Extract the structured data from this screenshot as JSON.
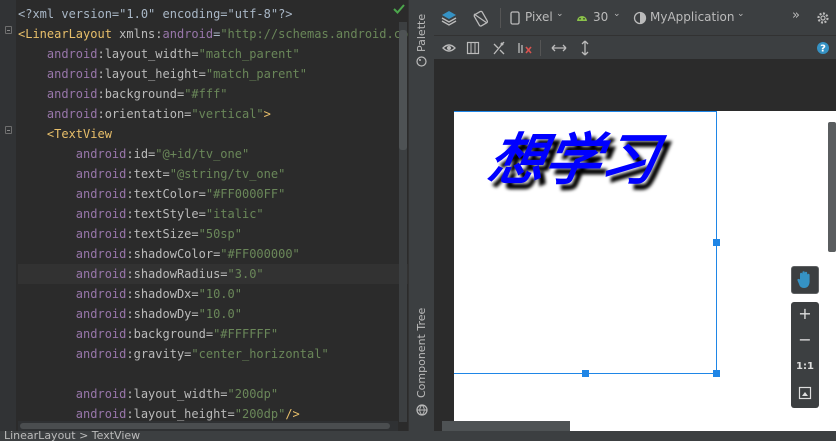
{
  "editor": {
    "lines": [
      [
        {
          "t": "<?xml version=\"1.0\" encoding=\"utf-8\"?>",
          "c": "tok-plain"
        }
      ],
      [
        {
          "t": "<LinearLayout ",
          "c": "tok-tag"
        },
        {
          "t": "xmlns:",
          "c": "tok-attr"
        },
        {
          "t": "android",
          "c": "tok-ns"
        },
        {
          "t": "=",
          "c": "tok-plain"
        },
        {
          "t": "\"http://schemas.android.com/",
          "c": "tok-str"
        }
      ],
      [
        {
          "t": "    ",
          "c": "tok-plain"
        },
        {
          "t": "android",
          "c": "tok-ns"
        },
        {
          "t": ":layout_width=",
          "c": "tok-attr"
        },
        {
          "t": "\"match_parent\"",
          "c": "tok-str"
        }
      ],
      [
        {
          "t": "    ",
          "c": "tok-plain"
        },
        {
          "t": "android",
          "c": "tok-ns"
        },
        {
          "t": ":layout_height=",
          "c": "tok-attr"
        },
        {
          "t": "\"match_parent\"",
          "c": "tok-str"
        }
      ],
      [
        {
          "t": "    ",
          "c": "tok-plain"
        },
        {
          "t": "android",
          "c": "tok-ns"
        },
        {
          "t": ":background=",
          "c": "tok-attr"
        },
        {
          "t": "\"#fff\"",
          "c": "tok-str"
        }
      ],
      [
        {
          "t": "    ",
          "c": "tok-plain"
        },
        {
          "t": "android",
          "c": "tok-ns"
        },
        {
          "t": ":orientation=",
          "c": "tok-attr"
        },
        {
          "t": "\"vertical\"",
          "c": "tok-str"
        },
        {
          "t": ">",
          "c": "tok-tag"
        }
      ],
      [
        {
          "t": "    ",
          "c": "tok-plain"
        },
        {
          "t": "<TextView",
          "c": "tok-tag"
        }
      ],
      [
        {
          "t": "        ",
          "c": "tok-plain"
        },
        {
          "t": "android",
          "c": "tok-ns"
        },
        {
          "t": ":id=",
          "c": "tok-attr"
        },
        {
          "t": "\"@+id/tv_one\"",
          "c": "tok-str"
        }
      ],
      [
        {
          "t": "        ",
          "c": "tok-plain"
        },
        {
          "t": "android",
          "c": "tok-ns"
        },
        {
          "t": ":text=",
          "c": "tok-attr"
        },
        {
          "t": "\"@string/tv_one\"",
          "c": "tok-str"
        }
      ],
      [
        {
          "t": "        ",
          "c": "tok-plain"
        },
        {
          "t": "android",
          "c": "tok-ns"
        },
        {
          "t": ":textColor=",
          "c": "tok-attr"
        },
        {
          "t": "\"#FF0000FF\"",
          "c": "tok-str"
        }
      ],
      [
        {
          "t": "        ",
          "c": "tok-plain"
        },
        {
          "t": "android",
          "c": "tok-ns"
        },
        {
          "t": ":textStyle=",
          "c": "tok-attr"
        },
        {
          "t": "\"italic\"",
          "c": "tok-str"
        }
      ],
      [
        {
          "t": "        ",
          "c": "tok-plain"
        },
        {
          "t": "android",
          "c": "tok-ns"
        },
        {
          "t": ":textSize=",
          "c": "tok-attr"
        },
        {
          "t": "\"50sp\"",
          "c": "tok-str"
        }
      ],
      [
        {
          "t": "        ",
          "c": "tok-plain"
        },
        {
          "t": "android",
          "c": "tok-ns"
        },
        {
          "t": ":shadowColor=",
          "c": "tok-attr"
        },
        {
          "t": "\"#FF000000\"",
          "c": "tok-str"
        }
      ],
      [
        {
          "t": "        ",
          "c": "tok-plain"
        },
        {
          "t": "android",
          "c": "tok-ns"
        },
        {
          "t": ":shadowRadius=",
          "c": "tok-attr"
        },
        {
          "t": "\"3.0\"",
          "c": "tok-str"
        }
      ],
      [
        {
          "t": "        ",
          "c": "tok-plain"
        },
        {
          "t": "android",
          "c": "tok-ns"
        },
        {
          "t": ":shadowDx=",
          "c": "tok-attr"
        },
        {
          "t": "\"10.0\"",
          "c": "tok-str"
        }
      ],
      [
        {
          "t": "        ",
          "c": "tok-plain"
        },
        {
          "t": "android",
          "c": "tok-ns"
        },
        {
          "t": ":shadowDy=",
          "c": "tok-attr"
        },
        {
          "t": "\"10.0\"",
          "c": "tok-str"
        }
      ],
      [
        {
          "t": "        ",
          "c": "tok-plain"
        },
        {
          "t": "android",
          "c": "tok-ns"
        },
        {
          "t": ":background=",
          "c": "tok-attr"
        },
        {
          "t": "\"#FFFFFF\"",
          "c": "tok-str"
        }
      ],
      [
        {
          "t": "        ",
          "c": "tok-plain"
        },
        {
          "t": "android",
          "c": "tok-ns"
        },
        {
          "t": ":gravity=",
          "c": "tok-attr"
        },
        {
          "t": "\"center_horizontal\"",
          "c": "tok-str"
        }
      ],
      [
        {
          "t": "",
          "c": "tok-plain"
        }
      ],
      [
        {
          "t": "        ",
          "c": "tok-plain"
        },
        {
          "t": "android",
          "c": "tok-ns"
        },
        {
          "t": ":layout_width=",
          "c": "tok-attr"
        },
        {
          "t": "\"200dp\"",
          "c": "tok-str"
        }
      ],
      [
        {
          "t": "        ",
          "c": "tok-plain"
        },
        {
          "t": "android",
          "c": "tok-ns"
        },
        {
          "t": ":layout_height=",
          "c": "tok-attr"
        },
        {
          "t": "\"200dp\"",
          "c": "tok-str"
        },
        {
          "t": "/>",
          "c": "tok-tag"
        }
      ]
    ],
    "highlighted_line": 13
  },
  "side_strip": {
    "palette_label": "Palette",
    "component_tree_label": "Component Tree"
  },
  "toolbar": {
    "device": "Pixel",
    "api": "30",
    "app": "MyApplication"
  },
  "preview": {
    "textview_text": "想学习",
    "text_color": "#0000ff",
    "selection_color": "#1f86e6"
  },
  "zoom": {
    "plus": "+",
    "minus": "−",
    "reset": "1:1"
  },
  "statusbar": {
    "breadcrumb": "LinearLayout  >  TextView"
  }
}
